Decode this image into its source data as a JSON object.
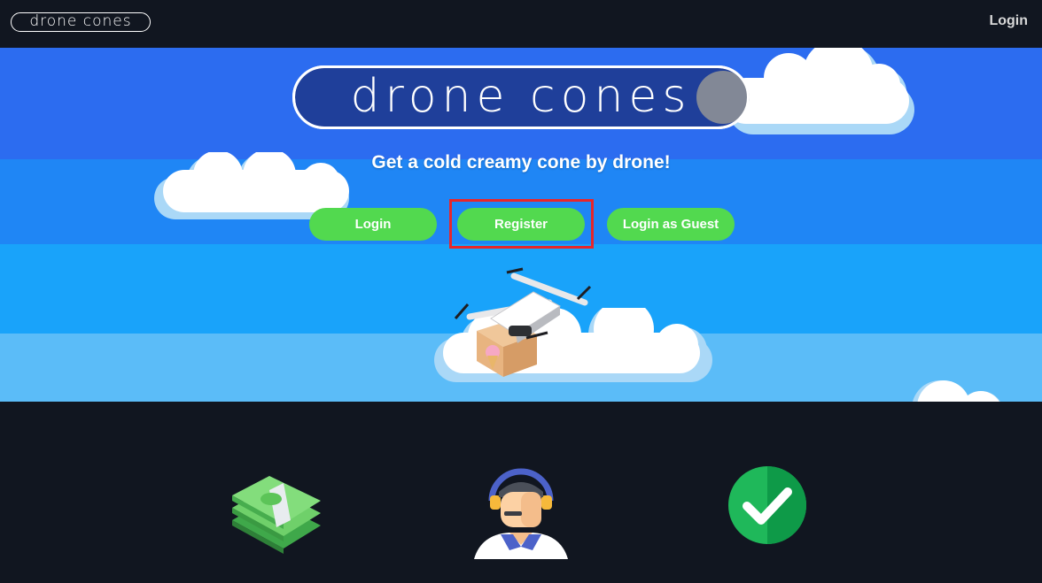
{
  "header": {
    "brand": "drone cones",
    "login_label": "Login"
  },
  "hero": {
    "logo_text": "drone cones",
    "tagline": "Get a cold creamy cone by drone!",
    "buttons": {
      "login": "Login",
      "register": "Register",
      "guest": "Login as Guest"
    }
  },
  "colors": {
    "button_green": "#52d94f",
    "highlight_red": "#e8262b",
    "sky_bands": [
      "#2c6cf0",
      "#1f86f5",
      "#19a3fa",
      "#5bbcf8"
    ],
    "dark_bg": "#111620"
  },
  "features": {
    "icons": [
      "money-stack-icon",
      "support-agent-icon",
      "checkmark-icon"
    ]
  }
}
